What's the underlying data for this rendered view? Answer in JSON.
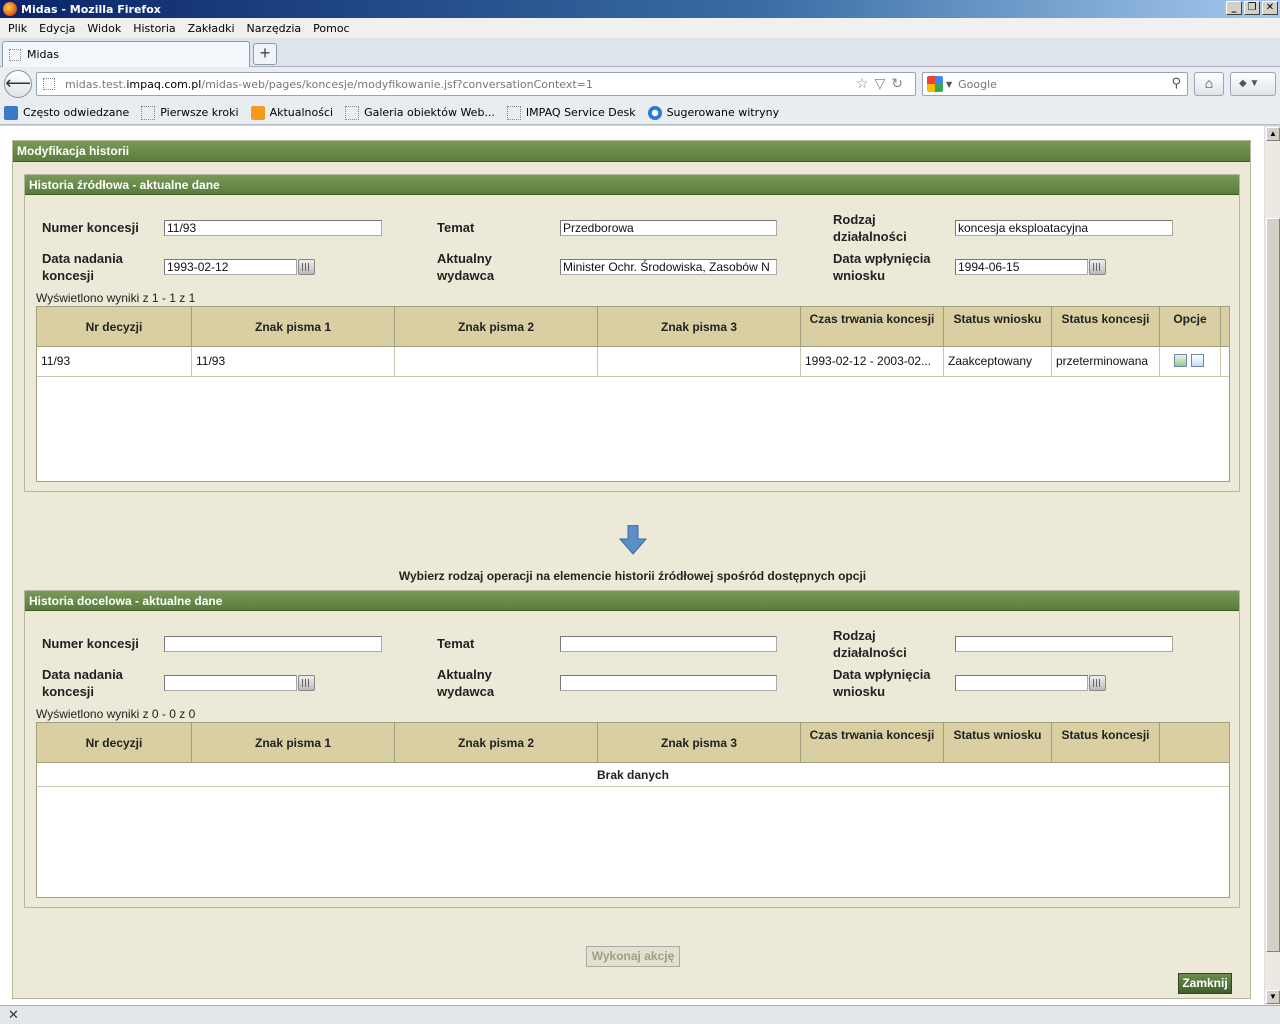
{
  "window": {
    "title": "Midas - Mozilla Firefox",
    "buttons": [
      "_",
      "❐",
      "✕"
    ]
  },
  "menu": [
    "Plik",
    "Edycja",
    "Widok",
    "Historia",
    "Zakładki",
    "Narzędzia",
    "Pomoc"
  ],
  "tab": {
    "title": "Midas",
    "new_tab_label": "+"
  },
  "nav": {
    "url_prefix": "midas.test.",
    "url_host": "impaq.com.pl",
    "url_path": "/midas-web/pages/koncesje/modyfikowanie.jsf?conversationContext=1",
    "search_placeholder": "Google",
    "search_engine_icon": "google-icon"
  },
  "bookmarks": [
    {
      "label": "Często odwiedzane",
      "icon": "most-visited-icon"
    },
    {
      "label": "Pierwsze kroki",
      "icon": "page-icon"
    },
    {
      "label": "Aktualności",
      "icon": "rss-icon"
    },
    {
      "label": "Galeria obiektów Web...",
      "icon": "page-icon"
    },
    {
      "label": "IMPAQ Service Desk",
      "icon": "page-icon"
    },
    {
      "label": "Sugerowane witryny",
      "icon": "ie-icon"
    }
  ],
  "page": {
    "title": "Modyfikacja historii",
    "source": {
      "title": "Historia źródłowa - aktualne dane",
      "labels": {
        "numer": "Numer koncesji",
        "temat": "Temat",
        "rodzaj": "Rodzaj działalności",
        "data_nadania": "Data nadania koncesji",
        "wydawca": "Aktualny wydawca",
        "data_wplyniecia": "Data wpłynięcia wniosku"
      },
      "values": {
        "numer": "11/93",
        "temat": "Przedborowa",
        "rodzaj": "koncesja eksploatacyjna",
        "data_nadania": "1993-02-12",
        "wydawca": "Minister Ochr. Środowiska, Zasobów N",
        "data_wplyniecia": "1994-06-15"
      },
      "results_info": "Wyświetlono wyniki z 1 - 1 z 1",
      "columns": [
        "Nr decyzji",
        "Znak pisma 1",
        "Znak pisma 2",
        "Znak pisma 3",
        "Czas trwania koncesji",
        "Status wniosku",
        "Status koncesji",
        "Opcje"
      ],
      "rows": [
        {
          "nr": "11/93",
          "znak1": "11/93",
          "znak2": "",
          "znak3": "",
          "czas": "1993-02-12 - 2003-02...",
          "status_wniosku": "Zaakceptowany",
          "status_koncesji": "przeterminowana"
        }
      ]
    },
    "instruction": "Wybierz rodzaj operacji na elemencie historii źródłowej spośród dostępnych opcji",
    "target": {
      "title": "Historia docelowa - aktualne dane",
      "labels": {
        "numer": "Numer koncesji",
        "temat": "Temat",
        "rodzaj": "Rodzaj działalności",
        "data_nadania": "Data nadania koncesji",
        "wydawca": "Aktualny wydawca",
        "data_wplyniecia": "Data wpłynięcia wniosku"
      },
      "values": {
        "numer": "",
        "temat": "",
        "rodzaj": "",
        "data_nadania": "",
        "wydawca": "",
        "data_wplyniecia": ""
      },
      "results_info": "Wyświetlono wyniki z 0 - 0 z 0",
      "columns": [
        "Nr decyzji",
        "Znak pisma 1",
        "Znak pisma 2",
        "Znak pisma 3",
        "Czas trwania koncesji",
        "Status wniosku",
        "Status koncesji"
      ],
      "no_data": "Brak danych"
    },
    "execute_label": "Wykonaj akcję",
    "close_label": "Zamknij"
  },
  "status": {
    "close_glyph": "✕"
  },
  "colors": {
    "header_green": "#5a7c3c",
    "panel_bg": "#ece9d8",
    "grid_header": "#d9cfa3"
  }
}
